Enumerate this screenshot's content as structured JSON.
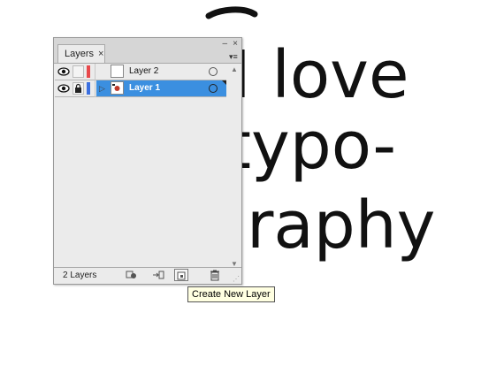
{
  "artwork": {
    "lines": [
      "I love",
      "typo-",
      "graphy"
    ]
  },
  "panel": {
    "tab_label": "Layers",
    "close_glyph": "×",
    "minimize_glyph": "–",
    "window_close_glyph": "×",
    "menu_glyph": "▾≡",
    "layer_count": "2 Layers",
    "layers": [
      {
        "name": "Layer 2",
        "color": "#e8484b",
        "selected": false,
        "locked": false
      },
      {
        "name": "Layer 1",
        "color": "#3b6fe0",
        "selected": true,
        "locked": true
      }
    ],
    "scroll_up": "▲",
    "scroll_down": "▼",
    "grip": "⋰"
  },
  "tooltip": {
    "text": "Create New Layer"
  },
  "colors": {
    "selection": "#3b8fe0",
    "tooltip_bg": "#ffffe1"
  }
}
